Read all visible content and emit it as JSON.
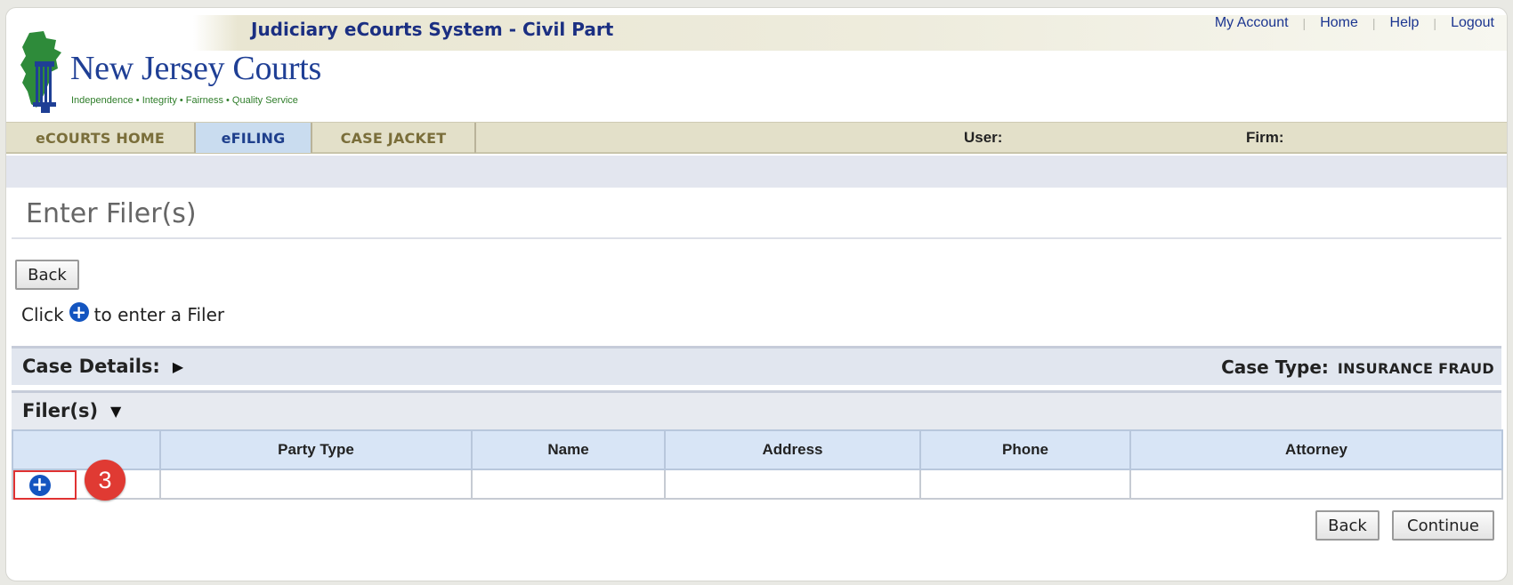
{
  "app": {
    "title": "Judiciary eCourts System - Civil Part",
    "logo_name": "New Jersey Courts",
    "logo_tagline": "Independence • Integrity • Fairness • Quality Service"
  },
  "top_links": {
    "my_account": "My Account",
    "home": "Home",
    "help": "Help",
    "logout": "Logout"
  },
  "nav": {
    "tabs": [
      {
        "label": "eCOURTS HOME"
      },
      {
        "label": "eFILING",
        "active": true
      },
      {
        "label": "CASE JACKET"
      }
    ],
    "user_label": "User:",
    "firm_label": "Firm:"
  },
  "page": {
    "title": "Enter Filer(s)",
    "back_label": "Back",
    "instruction_before": "Click",
    "instruction_after": "to enter a Filer"
  },
  "case_details": {
    "label": "Case Details:",
    "case_type_label": "Case Type:",
    "case_type_value": "INSURANCE FRAUD"
  },
  "filers": {
    "label": "Filer(s)",
    "columns": [
      "",
      "Party Type",
      "Name",
      "Address",
      "Phone",
      "Attorney"
    ],
    "step_badge": "3"
  },
  "footer_buttons": {
    "back": "Back",
    "continue": "Continue"
  },
  "colors": {
    "brand_blue": "#1b2f82",
    "tab_active_bg": "#c9dcef",
    "highlight_red": "#e03232",
    "plus_icon_blue": "#1455c0"
  },
  "icons": {
    "add": "plus-circle-icon",
    "case_details_toggle": "triangle-right-icon",
    "filers_toggle": "triangle-down-icon",
    "logo": "nj-state-column-icon"
  }
}
